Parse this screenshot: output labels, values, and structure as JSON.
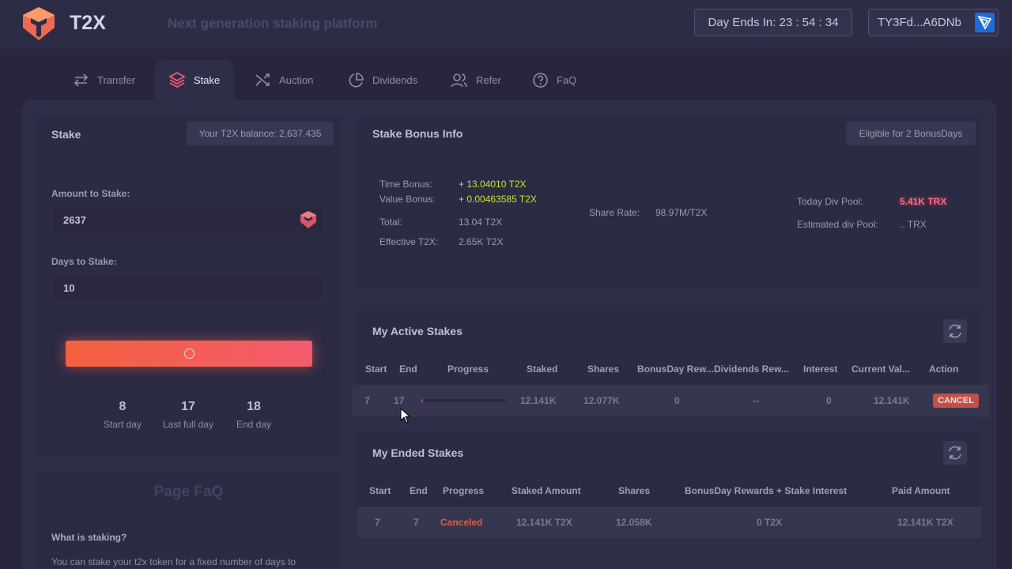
{
  "header": {
    "brand": "T2X",
    "tagline": "Next generation staking platform",
    "day_ends": "Day Ends In: 23 : 54 : 34",
    "wallet": "TY3Fd...A6DNb"
  },
  "tabs": [
    {
      "label": "Transfer",
      "icon": "transfer-icon",
      "active": false
    },
    {
      "label": "Stake",
      "icon": "layers-icon",
      "active": true
    },
    {
      "label": "Auction",
      "icon": "shuffle-icon",
      "active": false
    },
    {
      "label": "Dividends",
      "icon": "pie-chart-icon",
      "active": false
    },
    {
      "label": "Refer",
      "icon": "users-icon",
      "active": false
    },
    {
      "label": "FaQ",
      "icon": "help-circle-icon",
      "active": false
    }
  ],
  "stake_panel": {
    "title": "Stake",
    "balance": "Your T2X balance: 2,637.435",
    "amount_label": "Amount to Stake:",
    "amount_value": "2637",
    "days_label": "Days to Stake:",
    "days_value": "10",
    "days": [
      {
        "value": "8",
        "caption": "Start day"
      },
      {
        "value": "17",
        "caption": "Last full day"
      },
      {
        "value": "18",
        "caption": "End day"
      }
    ]
  },
  "faq": {
    "title": "Page FaQ",
    "question": "What is staking?",
    "answer": "You can stake your t2x token for a fixed number of days to"
  },
  "bonus_info": {
    "title": "Stake Bonus Info",
    "eligible": "Eligible for 2 BonusDays",
    "time_bonus_label": "Time Bonus:",
    "time_bonus_value": "+ 13.04010 T2X",
    "value_bonus_label": "Value Bonus:",
    "value_bonus_value": "+ 0.00463585 T2X",
    "total_label": "Total:",
    "total_value": "13.04 T2X",
    "effective_label": "Effective T2X:",
    "effective_value": "2.65K T2X",
    "share_rate_label": "Share Rate:",
    "share_rate_value": "98.97M/T2X",
    "today_pool_label": "Today Div Pool:",
    "today_pool_value": "5.41K TRX",
    "est_pool_label": "Estimated div Pool:",
    "est_pool_value": ".. TRX"
  },
  "active_stakes": {
    "title": "My Active Stakes",
    "headers": [
      "Start",
      "End",
      "Progress",
      "Staked",
      "Shares",
      "BonusDay Rew...",
      "Dividends Rew...",
      "Interest",
      "Current Val...",
      "Action"
    ],
    "row": {
      "start": "7",
      "end": "17",
      "progress": 0.02,
      "staked": "12.141K",
      "shares": "12.077K",
      "bonusday": "0",
      "dividends": "--",
      "interest": "0",
      "current": "12.141K",
      "action": "CANCEL"
    }
  },
  "ended_stakes": {
    "title": "My Ended Stakes",
    "headers": [
      "Start",
      "End",
      "Progress",
      "Staked Amount",
      "Shares",
      "BonusDay Rewards + Stake Interest",
      "Paid Amount"
    ],
    "row": {
      "start": "7",
      "end": "7",
      "progress": "Canceled",
      "staked": "12.141K T2X",
      "shares": "12.058K",
      "rewards": "0 T2X",
      "paid": "12.141K T2X"
    }
  },
  "colors": {
    "accent": "#f55b6e",
    "bonus_green": "#c8e534",
    "canceled": "#e05b45",
    "progress": "#9a4cff"
  }
}
